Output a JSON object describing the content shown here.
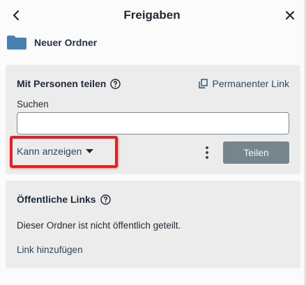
{
  "header": {
    "title": "Freigaben",
    "back_icon": "chevron-left-icon",
    "close_icon": "close-icon"
  },
  "folder": {
    "icon": "folder-icon",
    "name": "Neuer Ordner",
    "color": "#4a7fb5"
  },
  "share_section": {
    "heading": "Mit Personen teilen",
    "help_icon": "help-icon",
    "permanent_link_icon": "copy-icon",
    "permanent_link_label": "Permanenter Link",
    "search_label": "Suchen",
    "search_value": "",
    "permission_selected": "Kann anzeigen",
    "more_icon": "more-vertical-icon",
    "share_button_label": "Teilen"
  },
  "public_section": {
    "heading": "Öffentliche Links",
    "help_icon": "help-icon",
    "status_text": "Dieser Ordner ist nicht öffentlich geteilt.",
    "add_link_label": "Link hinzufügen"
  },
  "colors": {
    "accent": "#2b4658",
    "button_bg": "#76858d",
    "highlight": "#ee1c1c",
    "card_bg": "#ececec"
  }
}
